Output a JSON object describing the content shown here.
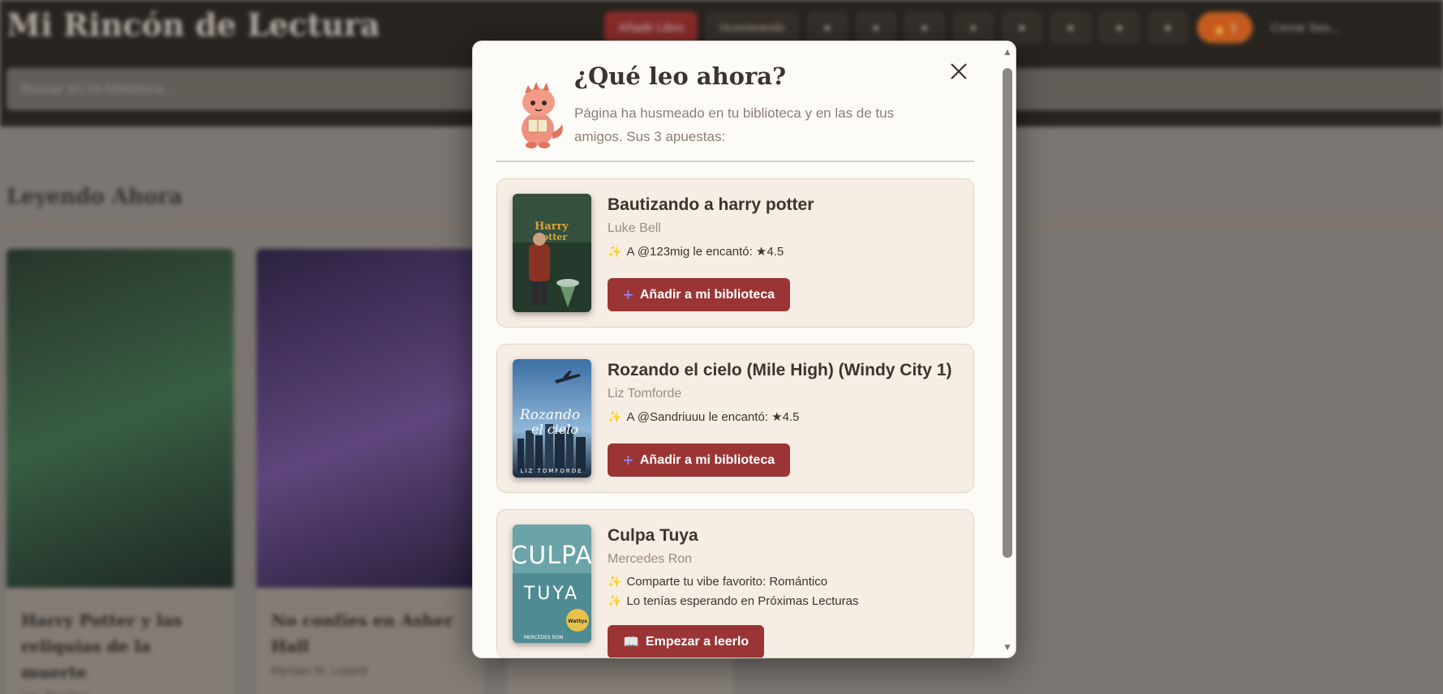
{
  "app": {
    "title": "Mi Rincón de Lectura",
    "nav": {
      "add_book": "Añadir Libro",
      "husmeando": "Husmeando",
      "streak": "1",
      "logout": "Cerrar Ses..."
    },
    "search_placeholder": "Buscar en mi biblioteca...",
    "section_title": "Leyendo Ahora",
    "books": [
      {
        "title": "Harry Potter y las reliquias de la muerte",
        "author": "J.K. Rowling"
      },
      {
        "title": "No confíes en Asher Hall",
        "author": "Myriam M. Lejardi"
      }
    ]
  },
  "modal": {
    "title": "¿Qué leo ahora?",
    "subtitle": "Página ha husmeado en tu biblioteca y en las de tus amigos. Sus 3 apuestas:",
    "suggestions": [
      {
        "title": "Bautizando a harry potter",
        "author": "Luke Bell",
        "reasons": [
          "A @123mig le encantó: ★4.5"
        ],
        "action": "Añadir a mi biblioteca",
        "action_icon": "plus-icon"
      },
      {
        "title": "Rozando el cielo (Mile High) (Windy City 1)",
        "author": "Liz Tomforde",
        "reasons": [
          "A @Sandriuuu le encantó: ★4.5"
        ],
        "action": "Añadir a mi biblioteca",
        "action_icon": "plus-icon"
      },
      {
        "title": "Culpa Tuya",
        "author": "Mercedes Ron",
        "reasons": [
          "Comparte tu vibe favorito: Romántico",
          "Lo tenías esperando en Próximas Lecturas"
        ],
        "action": "Empezar a leerlo",
        "action_icon": "book-icon"
      }
    ]
  },
  "colors": {
    "accent": "#9b3535",
    "card_bg": "#f6ede4",
    "modal_bg": "#fdfbf7",
    "streak": "#e2671f"
  }
}
